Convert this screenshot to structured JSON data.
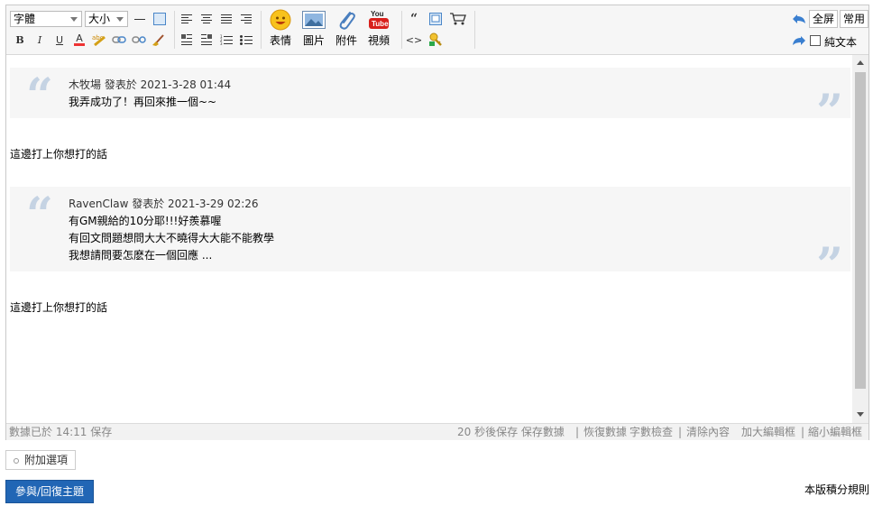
{
  "toolbar": {
    "font_select": "字體",
    "size_select": "大小",
    "emoticon_label": "表情",
    "image_label": "圖片",
    "attachment_label": "附件",
    "video_label": "視頻",
    "fullscreen_label": "全屏",
    "common_label": "常用",
    "plaintext_label": "純文本"
  },
  "quotes": [
    {
      "header": "木牧場 發表於 2021-3-28 01:44",
      "lines": [
        "我弄成功了！再回來推一個~~"
      ]
    },
    {
      "header": "RavenClaw 發表於 2021-3-29 02:26",
      "lines": [
        "有GM親給的10分耶!!!好羨慕喔",
        "有回文問題想問大大不曉得大大能不能教學",
        "我想請問要怎麽在一個回應 ..."
      ]
    }
  ],
  "paragraphs": [
    "這邊打上你想打的話",
    "這邊打上你想打的話"
  ],
  "status": {
    "saved_at": "數據已於 14:11 保存",
    "autosave": "20 秒後保存 保存數據",
    "restore": "恢復數據",
    "wordcheck": "字數檢查",
    "clear": "清除內容",
    "enlarge": "加大編輯框",
    "shrink": "縮小編輯框"
  },
  "extra_options": "附加選項",
  "submit_label": "參與/回復主題",
  "rules_link": "本版積分規則",
  "colors": {
    "quote_mark": "#c5d3e3",
    "submit_bg": "#2166b5"
  }
}
